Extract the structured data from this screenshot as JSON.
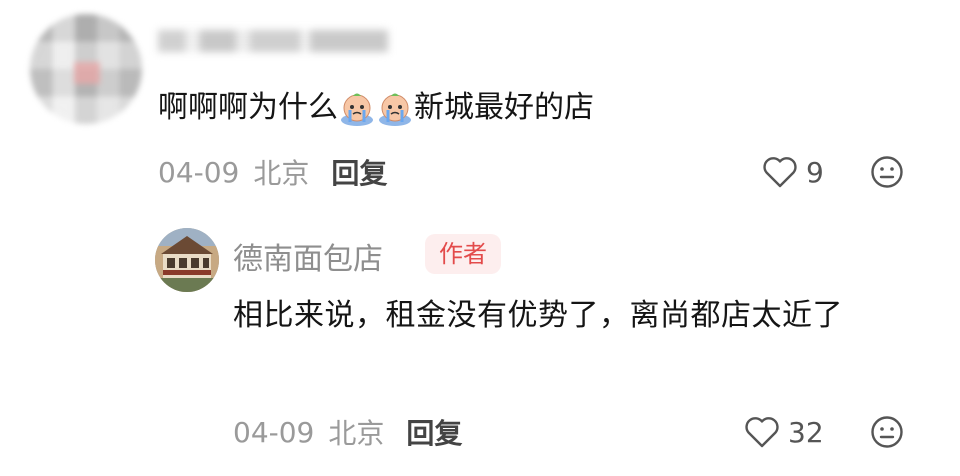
{
  "comment": {
    "text_prefix": "啊啊啊为什么",
    "emojis": [
      "crying-face-emoji",
      "crying-face-emoji"
    ],
    "text_suffix": "新城最好的店",
    "date": "04-09",
    "location": "北京",
    "reply_label": "回复",
    "likes": "9"
  },
  "reply": {
    "author": "德南面包店",
    "badge": "作者",
    "text": "相比来说，租金没有优势了，离尚都店太近了",
    "date": "04-09",
    "location": "北京",
    "reply_label": "回复",
    "likes": "32"
  },
  "colors": {
    "text": "#151515",
    "muted": "#9a9a9a",
    "badge_bg": "#fdeeee",
    "badge_text": "#e34b4b"
  }
}
